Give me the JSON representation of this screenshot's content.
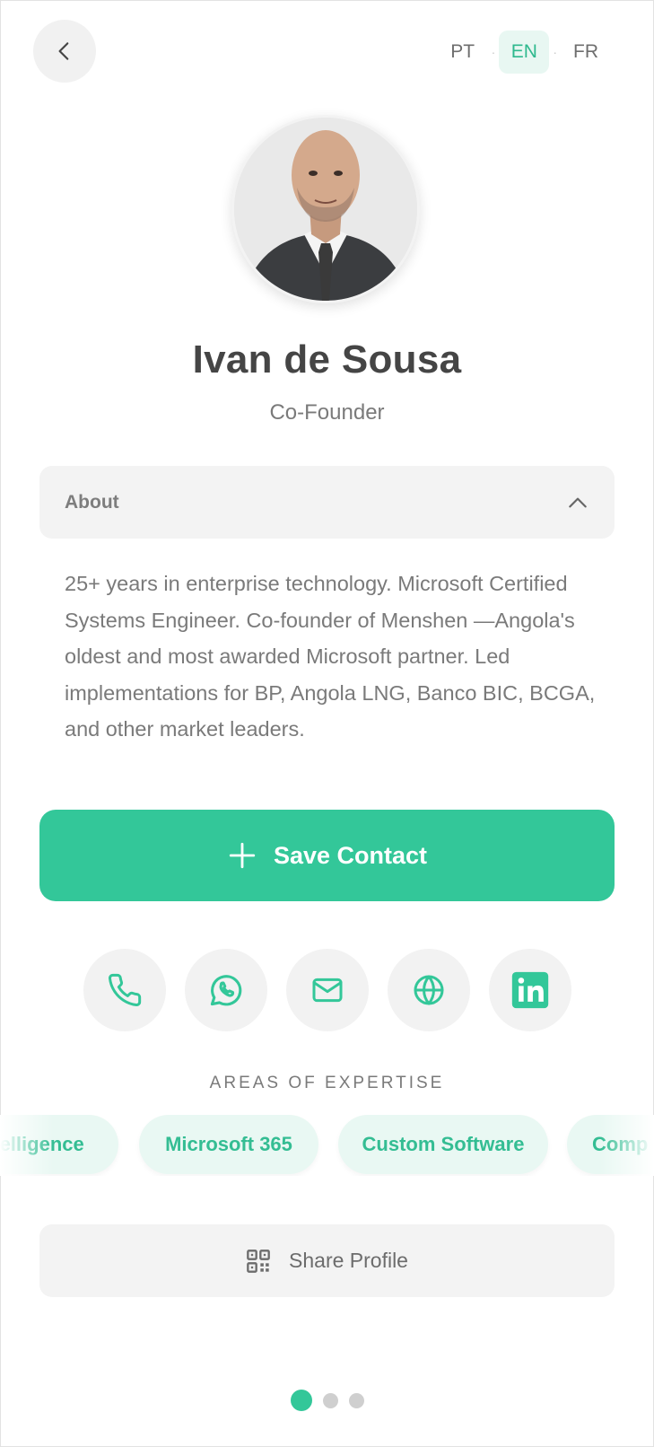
{
  "nav": {
    "back_icon": "chevron-left-icon"
  },
  "languages": [
    {
      "code": "PT",
      "active": false
    },
    {
      "code": "EN",
      "active": true
    },
    {
      "code": "FR",
      "active": false
    }
  ],
  "profile": {
    "name": "Ivan de Sousa",
    "role": "Co-Founder"
  },
  "about": {
    "title": "About",
    "expanded": true,
    "text": "25+ years in enterprise technology. Microsoft Certified Systems Engineer. Co-founder of Menshen —Angola's oldest and most awarded Microsoft partner. Led implementations for BP, Angola LNG, Banco BIC, BCGA, and other market leaders."
  },
  "save_button": {
    "label": "Save Contact",
    "icon": "plus-icon"
  },
  "contact_icons": [
    "phone-icon",
    "whatsapp-icon",
    "mail-icon",
    "globe-icon",
    "linkedin-icon"
  ],
  "expertise": {
    "label": "AREAS OF EXPERTISE",
    "chips": [
      "telligence",
      "Microsoft 365",
      "Custom Software",
      "Comp"
    ]
  },
  "share": {
    "label": "Share Profile",
    "icon": "qr-code-icon"
  },
  "pagination": {
    "pages": 3,
    "current": 1
  },
  "colors": {
    "accent": "#33c799",
    "chip_bg": "#e9f8f3",
    "chip_text": "#34bd93",
    "muted_bg": "#f3f3f3"
  }
}
